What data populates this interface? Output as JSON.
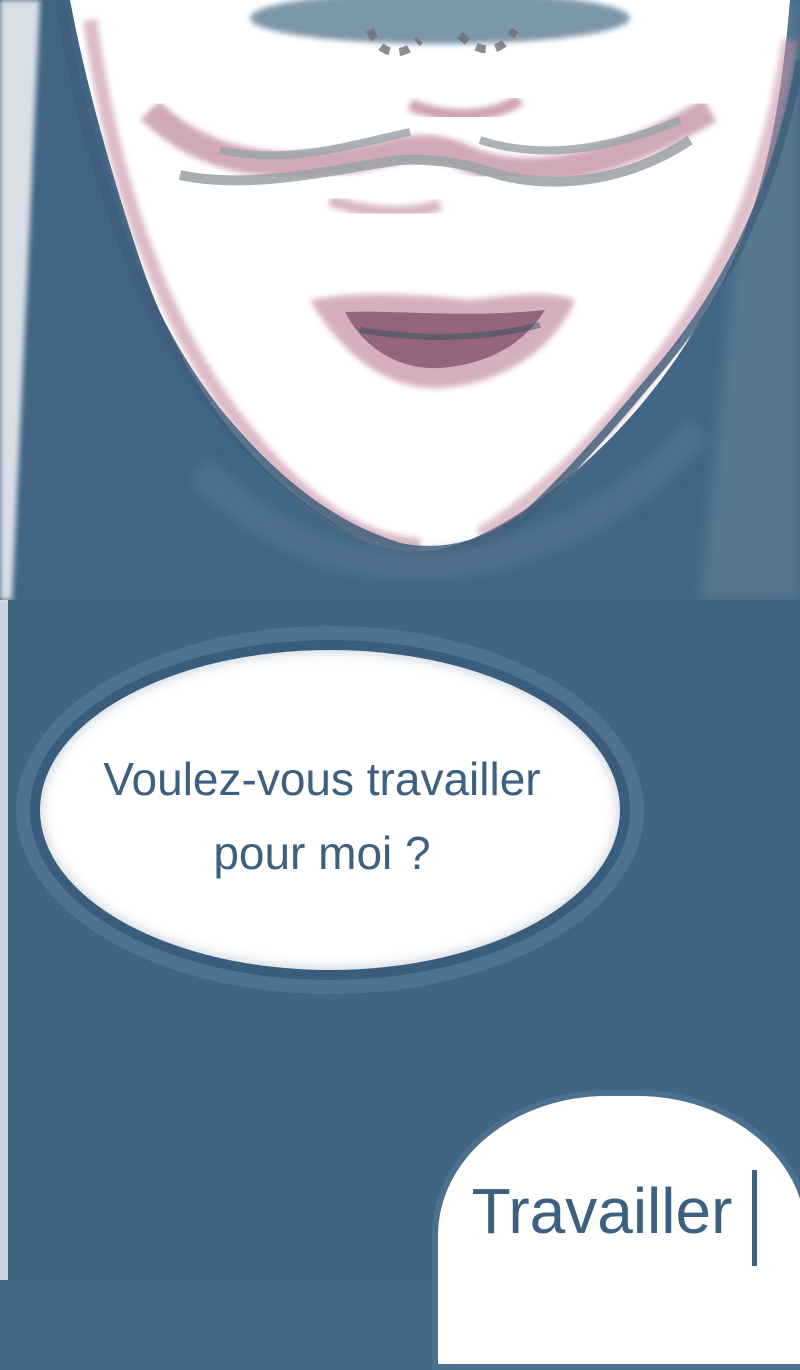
{
  "dialogue": {
    "line_1": "Voulez-vous travailler",
    "line_2": "pour moi ?"
  },
  "choices": [
    {
      "label": "Travailler"
    }
  ],
  "colors": {
    "ink_blue": "#416584",
    "text": "#3d5f80",
    "blush": "#b97b90",
    "paper": "#ffffff"
  },
  "scene": {
    "character": "portrait-lower-face-smiling"
  }
}
